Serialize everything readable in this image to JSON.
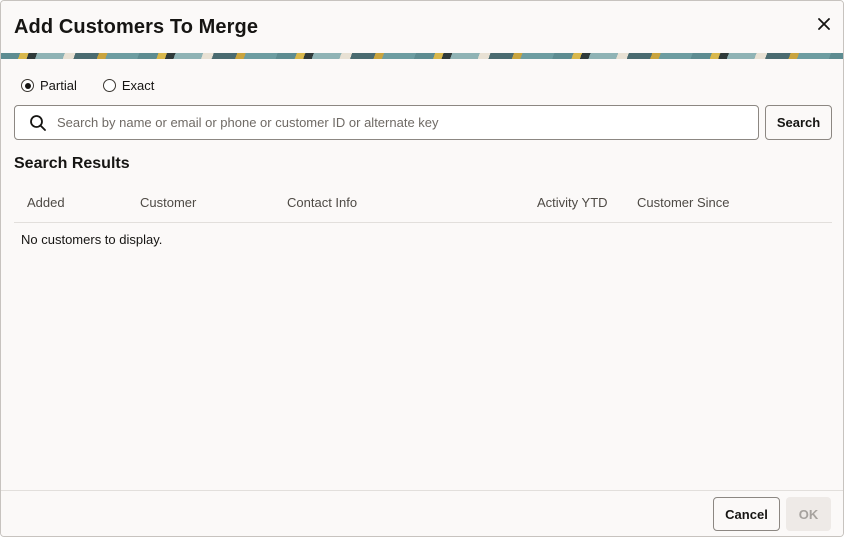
{
  "dialog": {
    "title": "Add Customers To Merge",
    "close_icon": "close-icon"
  },
  "match_mode": {
    "options": [
      {
        "label": "Partial",
        "selected": true
      },
      {
        "label": "Exact",
        "selected": false
      }
    ]
  },
  "search": {
    "placeholder": "Search by name or email or phone or customer ID or alternate key",
    "value": "",
    "button_label": "Search",
    "icon": "search-icon"
  },
  "results": {
    "title": "Search Results",
    "columns": [
      "Added",
      "Customer",
      "Contact Info",
      "Activity YTD",
      "Customer Since"
    ],
    "empty_message": "No customers to display."
  },
  "footer": {
    "cancel_label": "Cancel",
    "ok_label": "OK"
  },
  "colors": {
    "background": "#fbf9f8",
    "text": "#161513",
    "disabled": "#a6a29e"
  }
}
